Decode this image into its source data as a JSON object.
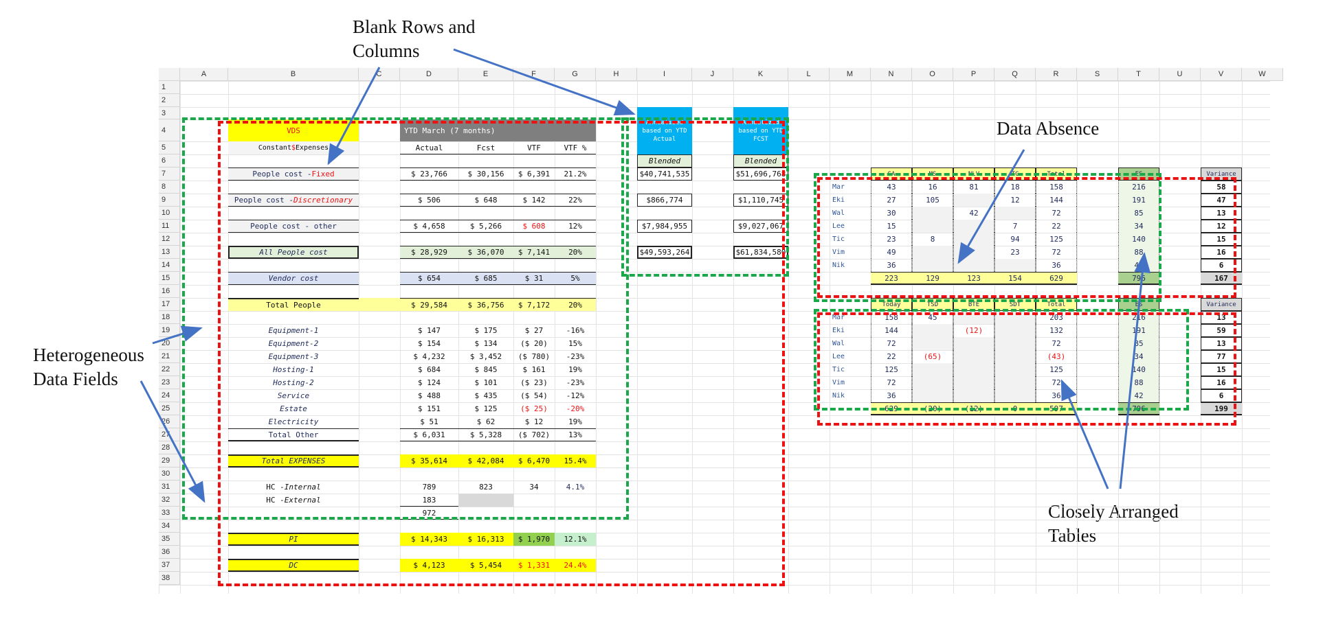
{
  "annotations": {
    "blank_rows_columns": "Blank Rows and\nColumns",
    "data_absence": "Data Absence",
    "heterogeneous": "Heterogeneous\nData Fields",
    "closely_arranged": "Closely Arranged\nTables"
  },
  "columns": [
    "A",
    "B",
    "C",
    "D",
    "E",
    "F",
    "G",
    "H",
    "I",
    "J",
    "K",
    "L",
    "M",
    "N",
    "O",
    "P",
    "Q",
    "R",
    "S",
    "T",
    "U",
    "V",
    "W"
  ],
  "rows": [
    "1",
    "2",
    "3",
    "4",
    "5",
    "6",
    "7",
    "8",
    "9",
    "10",
    "11",
    "12",
    "13",
    "14",
    "15",
    "16",
    "17",
    "18",
    "19",
    "20",
    "21",
    "22",
    "23",
    "24",
    "25",
    "26",
    "27",
    "28",
    "29",
    "30",
    "31",
    "32",
    "33",
    "34",
    "35",
    "36",
    "37",
    "38"
  ],
  "main": {
    "vds": "VDS",
    "ytd_header": "YTD March (7 months)",
    "constant_pre": "Constant ",
    "constant_dollar": "$",
    "constant_post": " Expenses",
    "col_actual": "Actual",
    "col_fcst": "Fcst",
    "col_vtf": "VTF",
    "col_vtf_pct": "VTF %",
    "annual_actual": "Annualized based on YTD Actual",
    "annual_fcst": "Annualized based on YTD FCST",
    "blended": "Blended",
    "people_fixed_pre": "People cost - ",
    "people_fixed_suf": "Fixed",
    "people_fixed": [
      "$ 23,766",
      "$ 30,156",
      "$ 6,391",
      "21.2%",
      "$40,741,535",
      "$51,696,768"
    ],
    "people_disc_pre": "People cost - ",
    "people_disc_suf": "Discretionary",
    "people_disc": [
      "$ 506",
      "$ 648",
      "$ 142",
      "22%",
      "$866,774",
      "$1,110,745"
    ],
    "people_other": "People cost - other",
    "people_other_vals": [
      "$ 4,658",
      "$ 5,266",
      "$ 608",
      "12%",
      "$7,984,955",
      "$9,027,067"
    ],
    "all_people": "All People cost",
    "all_people_vals": [
      "$ 28,929",
      "$ 36,070",
      "$ 7,141",
      "20%",
      "$49,593,264",
      "$61,834,580"
    ],
    "vendor": "Vendor cost",
    "vendor_vals": [
      "$ 654",
      "$ 685",
      "$ 31",
      "5%"
    ],
    "total_people": "Total People",
    "total_people_vals": [
      "$ 29,584",
      "$ 36,756",
      "$ 7,172",
      "20%"
    ],
    "other_items": [
      {
        "label": "Equipment-1",
        "v": [
          "$ 147",
          "$ 175",
          "$ 27",
          "-16%"
        ]
      },
      {
        "label": "Equipment-2",
        "v": [
          "$ 154",
          "$ 134",
          "($ 20)",
          "15%"
        ]
      },
      {
        "label": "Equipment-3",
        "v": [
          "$ 4,232",
          "$ 3,452",
          "($ 780)",
          "-23%"
        ]
      },
      {
        "label": "Hosting-1",
        "v": [
          "$ 684",
          "$ 845",
          "$ 161",
          "19%"
        ]
      },
      {
        "label": "Hosting-2",
        "v": [
          "$ 124",
          "$ 101",
          "($ 23)",
          "-23%"
        ]
      },
      {
        "label": "Service",
        "v": [
          "$ 488",
          "$ 435",
          "($ 54)",
          "-12%"
        ]
      },
      {
        "label": "Estate",
        "v": [
          "$ 151",
          "$ 125",
          "($ 25)",
          "-20%"
        ]
      },
      {
        "label": "Electricity",
        "v": [
          "$ 51",
          "$ 62",
          "$ 12",
          "19%"
        ]
      }
    ],
    "total_other": "Total Other",
    "total_other_vals": [
      "$ 6,031",
      "$ 5,328",
      "($ 702)",
      "13%"
    ],
    "total_expenses": "Total EXPENSES",
    "total_expenses_vals": [
      "$ 35,614",
      "$ 42,084",
      "$ 6,470",
      "15.4%"
    ],
    "hc_internal_pre": "HC - ",
    "hc_internal_suf": "Internal",
    "hc_internal_vals": [
      "789",
      "823",
      "34",
      "4.1%"
    ],
    "hc_external_pre": "HC - ",
    "hc_external_suf": "External",
    "hc_external_val": "183",
    "hc_total": "972",
    "pi": "PI",
    "pi_vals": [
      "$ 14,343",
      "$ 16,313",
      "$ 1,970",
      "12.1%"
    ],
    "dc": "DC",
    "dc_vals": [
      "$ 4,123",
      "$ 5,454",
      "$ 1,331",
      "24.4%"
    ]
  },
  "table1": {
    "headers": [
      "SA",
      "MS",
      "NLV",
      "TC",
      "Total",
      "",
      "ES",
      "",
      "Variance"
    ],
    "rows": [
      {
        "name": "Mar",
        "v": [
          "43",
          "16",
          "81",
          "18",
          "158",
          "216",
          "58"
        ]
      },
      {
        "name": "Eki",
        "v": [
          "27",
          "105",
          "",
          "12",
          "144",
          "191",
          "47"
        ]
      },
      {
        "name": "Wal",
        "v": [
          "30",
          "",
          "42",
          "",
          "72",
          "85",
          "13"
        ]
      },
      {
        "name": "Lee",
        "v": [
          "15",
          "",
          "",
          "7",
          "22",
          "34",
          "12"
        ]
      },
      {
        "name": "Tic",
        "v": [
          "23",
          "8",
          "",
          "94",
          "125",
          "140",
          "15"
        ]
      },
      {
        "name": "Vim",
        "v": [
          "49",
          "",
          "",
          "23",
          "72",
          "88",
          "16"
        ]
      },
      {
        "name": "Nik",
        "v": [
          "36",
          "",
          "",
          "",
          "36",
          "42",
          "6"
        ]
      }
    ],
    "totals": [
      "223",
      "129",
      "123",
      "154",
      "629",
      "796",
      "167"
    ]
  },
  "table2": {
    "headers": [
      "Today",
      "TSD",
      "BTE",
      "SDT",
      "Total",
      "",
      "ES",
      "",
      "Variance"
    ],
    "rows": [
      {
        "name": "Mar",
        "v": [
          "158",
          "45",
          "",
          "",
          "203",
          "216",
          "13"
        ]
      },
      {
        "name": "Eki",
        "v": [
          "144",
          "",
          "(12)",
          "",
          "132",
          "191",
          "59"
        ]
      },
      {
        "name": "Wal",
        "v": [
          "72",
          "",
          "",
          "",
          "72",
          "85",
          "13"
        ]
      },
      {
        "name": "Lee",
        "v": [
          "22",
          "(65)",
          "",
          "",
          "(43)",
          "34",
          "77"
        ]
      },
      {
        "name": "Tic",
        "v": [
          "125",
          "",
          "",
          "",
          "125",
          "140",
          "15"
        ]
      },
      {
        "name": "Vim",
        "v": [
          "72",
          "",
          "",
          "",
          "72",
          "88",
          "16"
        ]
      },
      {
        "name": "Nik",
        "v": [
          "36",
          "",
          "",
          "",
          "36",
          "42",
          "6"
        ]
      }
    ],
    "totals": [
      "629",
      "(20)",
      "(12)",
      "0",
      "597",
      "796",
      "199"
    ]
  }
}
